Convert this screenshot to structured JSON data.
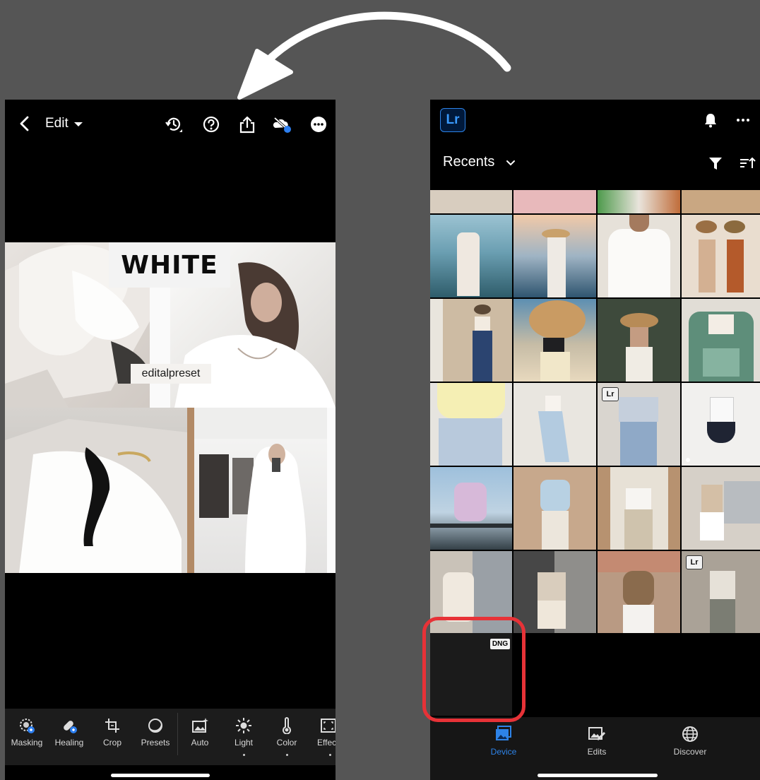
{
  "left_phone": {
    "header": {
      "back_icon": "chevron-left-icon",
      "edit_label": "Edit",
      "icons": [
        "history-icon",
        "help-icon",
        "share-icon",
        "cloud-sync-icon",
        "more-icon"
      ]
    },
    "photo": {
      "overlay_title": "WHITE",
      "overlay_caption": "editalpreset"
    },
    "toolbar": [
      {
        "label": "Masking",
        "icon": "masking-icon"
      },
      {
        "label": "Healing",
        "icon": "healing-icon"
      },
      {
        "label": "Crop",
        "icon": "crop-icon"
      },
      {
        "label": "Presets",
        "icon": "presets-icon"
      },
      {
        "label": "Auto",
        "icon": "auto-icon"
      },
      {
        "label": "Light",
        "icon": "light-icon"
      },
      {
        "label": "Color",
        "icon": "color-icon"
      },
      {
        "label": "Effec",
        "icon": "effects-icon"
      }
    ]
  },
  "right_phone": {
    "app_logo": "Lr",
    "header_icons": [
      "bell-icon",
      "more-icon"
    ],
    "album": {
      "title": "Recents",
      "chevron_icon": "chevron-down-icon",
      "filter_icon": "filter-icon",
      "sort_icon": "sort-icon"
    },
    "grid_badges": [
      "Lr",
      "Lr"
    ],
    "dng_badge": "DNG",
    "bottom_nav": [
      {
        "label": "Device",
        "icon": "device-icon",
        "active": true
      },
      {
        "label": "Edits",
        "icon": "edits-icon",
        "active": false
      },
      {
        "label": "Discover",
        "icon": "discover-icon",
        "active": false
      }
    ]
  },
  "colors": {
    "background": "#555555",
    "highlight_ring": "#e73237",
    "active_accent": "#2d83e8",
    "arrow": "#ffffff"
  }
}
